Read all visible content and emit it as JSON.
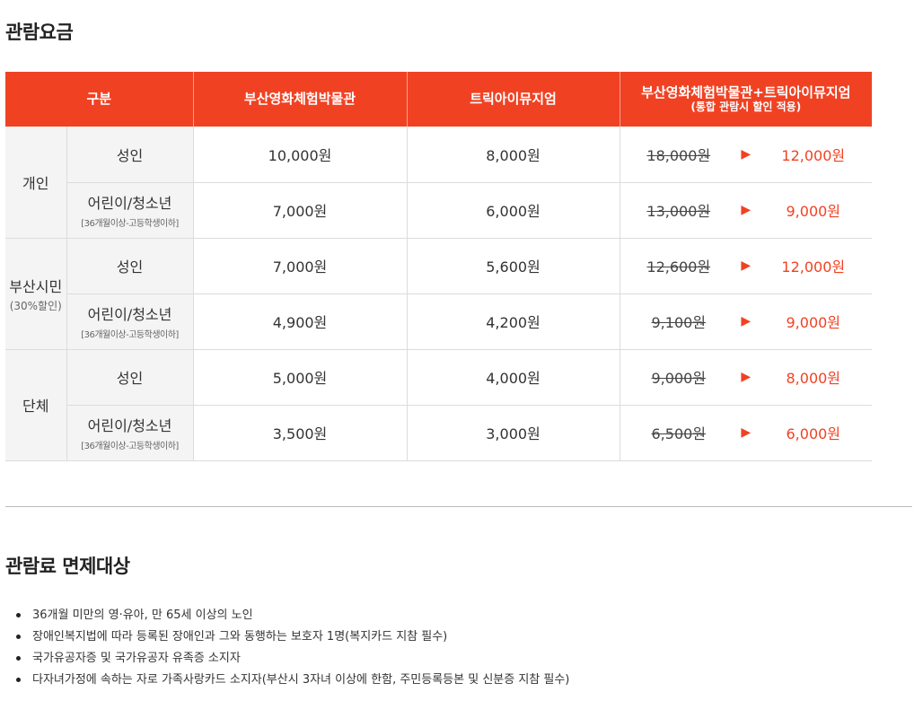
{
  "section1": {
    "title": "관람요금"
  },
  "table": {
    "headers": {
      "category": "구분",
      "museum": "부산영화체험박물관",
      "trickeye": "트릭아이뮤지엄",
      "combined": "부산영화체험박물관+트릭아이뮤지엄",
      "combined_sub": "(통합 관람시 할인 적용)"
    },
    "groups": [
      {
        "name": "개인",
        "note": ""
      },
      {
        "name": "부산시민",
        "note": "(30%할인)"
      },
      {
        "name": "단체",
        "note": ""
      }
    ],
    "rows": [
      {
        "label": "성인",
        "note": "",
        "museum": "10,000원",
        "trickeye": "8,000원",
        "combined_old": "18,000원",
        "combined_new": "12,000원"
      },
      {
        "label": "어린이/청소년",
        "note": "[36개월이상-고등학생이하]",
        "museum": "7,000원",
        "trickeye": "6,000원",
        "combined_old": "13,000원",
        "combined_new": "9,000원"
      },
      {
        "label": "성인",
        "note": "",
        "museum": "7,000원",
        "trickeye": "5,600원",
        "combined_old": "12,600원",
        "combined_new": "12,000원"
      },
      {
        "label": "어린이/청소년",
        "note": "[36개월이상-고등학생이하]",
        "museum": "4,900원",
        "trickeye": "4,200원",
        "combined_old": "9,100원",
        "combined_new": "9,000원"
      },
      {
        "label": "성인",
        "note": "",
        "museum": "5,000원",
        "trickeye": "4,000원",
        "combined_old": "9,000원",
        "combined_new": "8,000원"
      },
      {
        "label": "어린이/청소년",
        "note": "[36개월이상-고등학생이하]",
        "museum": "3,500원",
        "trickeye": "3,000원",
        "combined_old": "6,500원",
        "combined_new": "6,000원"
      }
    ],
    "arrow_glyph": "▶",
    "accent_color": "#f04223"
  },
  "section2": {
    "title": "관람료 면제대상",
    "items": [
      "36개월 미만의 영·유아, 만 65세 이상의 노인",
      "장애인복지법에 따라 등록된 장애인과 그와 동행하는 보호자 1명(복지카드 지참 필수)",
      "국가유공자증 및 국가유공자 유족증 소지자",
      "다자녀가정에 속하는 자로 가족사랑카드 소지자(부산시 3자녀 이상에 한함, 주민등록등본 및 신분증 지참 필수)"
    ]
  }
}
